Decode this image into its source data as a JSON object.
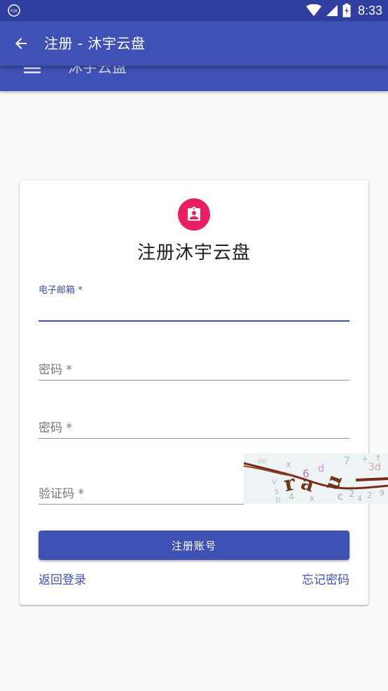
{
  "status_bar": {
    "time": "8:33"
  },
  "app_bar": {
    "title": "注册 - 沐宇云盘"
  },
  "behind_bar": {
    "title": "沐宇云盘"
  },
  "card": {
    "title": "注册沐宇云盘",
    "fields": {
      "email": {
        "label": "电子邮箱 *",
        "value": ""
      },
      "password": {
        "label": "密码 *",
        "value": ""
      },
      "password_confirm": {
        "label": "密码 *",
        "value": ""
      },
      "captcha": {
        "label": "验证码 *",
        "value": ""
      }
    },
    "submit_label": "注册账号",
    "back_to_login": "返回登录",
    "forgot_password": "忘记密码"
  },
  "colors": {
    "primary": "#3f51b5",
    "primary_dark": "#303f9f",
    "avatar_accent": "#e91e63"
  }
}
